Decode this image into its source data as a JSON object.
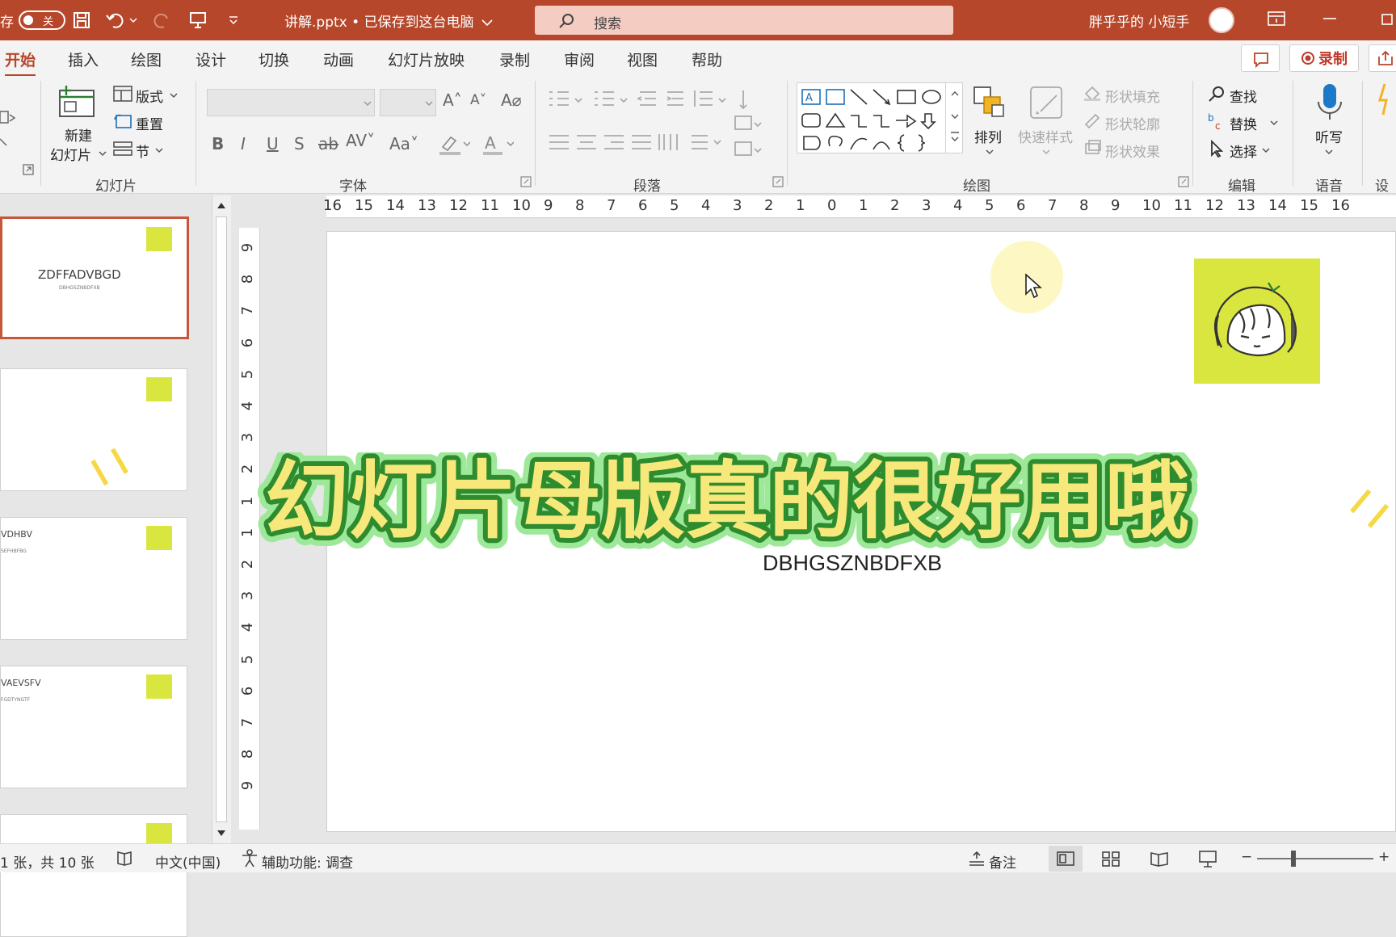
{
  "titlebar": {
    "autosave_label": "存",
    "autosave_state": "关",
    "filename": "讲解.pptx • 已保存到这台电脑",
    "search_placeholder": "搜索",
    "user_name": "胖乎乎的 小短手"
  },
  "tabs": [
    "开始",
    "插入",
    "绘图",
    "设计",
    "切换",
    "动画",
    "幻灯片放映",
    "录制",
    "审阅",
    "视图",
    "帮助"
  ],
  "active_tab": "开始",
  "record_button": "录制",
  "ribbon": {
    "slides_group": {
      "label": "幻灯片",
      "new_slide_line1": "新建",
      "new_slide_line2": "幻灯片",
      "layout": "版式",
      "reset": "重置",
      "section": "节"
    },
    "font_group": {
      "label": "字体",
      "font_name": "",
      "font_size": ""
    },
    "paragraph_group": {
      "label": "段落"
    },
    "drawing_group": {
      "label": "绘图",
      "arrange": "排列",
      "quick_styles": "快速样式",
      "shape_fill": "形状填充",
      "shape_outline": "形状轮廓",
      "shape_effects": "形状效果"
    },
    "editing_group": {
      "label": "编辑",
      "find": "查找",
      "replace": "替换",
      "select": "选择"
    },
    "voice_group": {
      "label": "语音",
      "dictate": "听写"
    },
    "designer_group": {
      "label": "设计"
    }
  },
  "hruler_ticks": [
    "16",
    "15",
    "14",
    "13",
    "12",
    "11",
    "10",
    "9",
    "8",
    "7",
    "6",
    "5",
    "4",
    "3",
    "2",
    "1",
    "0",
    "1",
    "2",
    "3",
    "4",
    "5",
    "6",
    "7",
    "8",
    "9",
    "10",
    "11",
    "12",
    "13",
    "14",
    "15",
    "16"
  ],
  "vruler_ticks": [
    "9",
    "8",
    "7",
    "6",
    "5",
    "4",
    "3",
    "2",
    "1",
    "1",
    "2",
    "3",
    "4",
    "5",
    "6",
    "7",
    "8",
    "9"
  ],
  "thumbnails": [
    {
      "title": "ZDFFADVBGD",
      "subtitle": "DBHGSZNBDFXB",
      "selected": true
    },
    {
      "title": "",
      "subtitle": "",
      "selected": false
    },
    {
      "title": "VDHBV",
      "subtitle": "SEFHBFBG",
      "selected": false
    },
    {
      "title": "VAEVSFV",
      "subtitle": "FGDTYNGTF",
      "selected": false
    },
    {
      "title": "",
      "subtitle": "",
      "selected": false
    }
  ],
  "slide": {
    "subtitle": "DBHGSZNBDFXB"
  },
  "caption": "幻灯片母版真的很好用哦",
  "statusbar": {
    "slide_info": "1 张，共 10 张",
    "language": "中文(中国)",
    "accessibility": "辅助功能: 调查",
    "notes": "备注"
  },
  "colors": {
    "accent": "#b7472a",
    "logo_bg": "#d9e640",
    "caption_fill": "#f6e87a",
    "caption_stroke": "#2e8b2e"
  }
}
